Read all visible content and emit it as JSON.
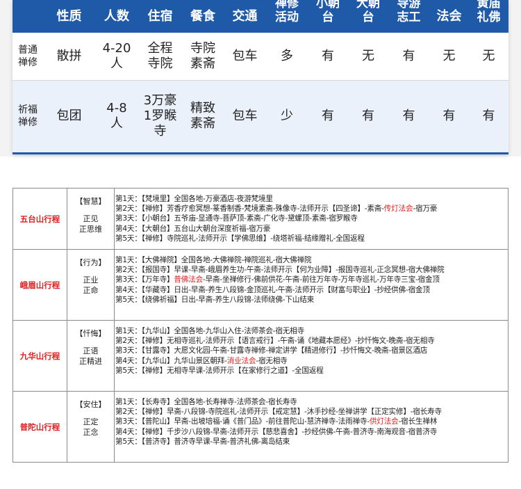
{
  "comparison": {
    "headers": [
      "",
      "性质",
      "人数",
      "住宿",
      "餐食",
      "交通",
      "禅修\n活动",
      "小朝\n台",
      "大朝\n台",
      "导游\n志工",
      "法会",
      "黄庙\n礼佛"
    ],
    "rows": [
      {
        "label": "普通\n禅修",
        "cells": [
          "散拼",
          "4-20\n人",
          "全程\n寺院",
          "寺院\n素斋",
          "包车",
          "多",
          "有",
          "无",
          "有",
          "无",
          "无"
        ],
        "red": [
          true,
          true,
          true,
          false,
          false,
          false,
          false,
          true,
          false,
          true,
          true
        ]
      },
      {
        "label": "祈福\n禅修",
        "cells": [
          "包团",
          "4-8\n人",
          "3万豪\n1罗睺\n寺",
          "精致\n素斋",
          "包车",
          "少",
          "有",
          "有",
          "有",
          "有",
          "有"
        ],
        "red": [
          true,
          true,
          true,
          true,
          false,
          false,
          false,
          true,
          false,
          true,
          true
        ]
      }
    ]
  },
  "itinerary": [
    {
      "name": "五台山行程",
      "tag": "【智慧】",
      "motto": "正见\n正思维",
      "days": [
        {
          "label": "第1天：",
          "parts": [
            {
              "t": "【梵境里】全国各地-万豪酒店-夜游梵境里"
            }
          ]
        },
        {
          "label": "第2天：",
          "parts": [
            {
              "t": "【禅修】芳香疗愈冥想-篆香制香-梵境素斋-殊像寺-法师开示【四圣谛】-素斋-"
            },
            {
              "t": "传灯法会",
              "hl": true
            },
            {
              "t": "-宿万豪"
            }
          ]
        },
        {
          "label": "第3天：",
          "parts": [
            {
              "t": "【小朝台】五爷庙-显通寺-菩萨顶-素斋-广化寺-黛螺顶-素斋-宿罗睺寺"
            }
          ]
        },
        {
          "label": "第4天：",
          "parts": [
            {
              "t": "【大朝台】五台山大朝台深度祈福-宿万豪"
            }
          ]
        },
        {
          "label": "第5天：",
          "parts": [
            {
              "t": "【禅修】寺院巡礼-法师开示【学佛思维】-绕塔祈福-结缘赠礼-全国返程"
            }
          ]
        }
      ]
    },
    {
      "name": "峨眉山行程",
      "tag": "【行为】",
      "motto": "正业\n正命",
      "days": [
        {
          "label": "第1天：",
          "parts": [
            {
              "t": "【大佛禅院】全国各地-大佛禅院-禅院巡礼-宿大佛禅院"
            }
          ]
        },
        {
          "label": "第2天：",
          "parts": [
            {
              "t": "【报国寺】早课-早斋-峨眉养生功-午斋-法师开示【何为业障】-报国寺巡礼-正念冥想-宿大佛禅院"
            }
          ]
        },
        {
          "label": "第3天：",
          "parts": [
            {
              "t": "【万年寺】"
            },
            {
              "t": "普佛法会",
              "hl": true
            },
            {
              "t": "-早斋-坐禅修行-佛前供花-午斋-前往万年寺-万年寺巡礼-万年寺三宝-宿金顶"
            }
          ]
        },
        {
          "label": "第4天：",
          "parts": [
            {
              "t": "【华藏寺】日出-早斋-养生八段锦-金顶巡礼-午斋-法师开示【财富与职业】-抄经供佛-宿金顶"
            }
          ]
        },
        {
          "label": "第5天：",
          "parts": [
            {
              "t": "【绕佛祈福】日出-早斋-养生八段锦-法师绕佛-下山结束"
            }
          ]
        }
      ]
    },
    {
      "name": "九华山行程",
      "tag": "【忏悔】",
      "motto": "正语\n正精进",
      "days": [
        {
          "label": "第1天：",
          "parts": [
            {
              "t": "【九华山】全国各地-九华山入住-法师茶会-宿无相寺"
            }
          ]
        },
        {
          "label": "第2天：",
          "parts": [
            {
              "t": "【禅修】无相寺巡礼-法师开示【语言戒行】-午斋-诵《地藏本愿经》-抄忏悔文-晚斋-宿无相寺"
            }
          ]
        },
        {
          "label": "第3天：",
          "parts": [
            {
              "t": "【甘露寺】大愿文化园-午斋-甘露寺禅修-禅定讲学【精进修行】-抄忏悔文-晚斋-宿景区酒店"
            }
          ]
        },
        {
          "label": "第4天：",
          "parts": [
            {
              "t": "【九华山】九华山景区朝拜-"
            },
            {
              "t": "消业法会",
              "hl": true
            },
            {
              "t": "-宿无相寺"
            }
          ]
        },
        {
          "label": "第5天：",
          "parts": [
            {
              "t": "【禅修】无相寺早课-法师开示【在家修行之道】-全国返程"
            }
          ]
        }
      ]
    },
    {
      "name": "普陀山行程",
      "tag": "【安住】",
      "motto": "正定\n正念",
      "days": [
        {
          "label": "第1天：",
          "parts": [
            {
              "t": "【长寿寺】全国各地-长寿禅寺-法师茶会-宿长寿寺"
            }
          ]
        },
        {
          "label": "第2天：",
          "parts": [
            {
              "t": "【禅修】早斋-八段锦-寺院巡礼-法师开示【戒定慧】-沐手抄经-坐禅讲学【正定实修】-宿长寿寺"
            }
          ]
        },
        {
          "label": "第3天：",
          "parts": [
            {
              "t": "【普陀山】早斋-出坡培福-诵《普门品》-前往普陀山-慧济禅寺-法雨禅寺-"
            },
            {
              "t": "供灯法会",
              "hl": true
            },
            {
              "t": "-宿长生禅林"
            }
          ]
        },
        {
          "label": "第4天：",
          "parts": [
            {
              "t": "【禅修】千步沙八段锦-早斋-法师开示【慈悲喜舍】-抄经供佛-午斋-普济寺-南海观音-宿普济寺"
            }
          ]
        },
        {
          "label": "第5天：",
          "parts": [
            {
              "t": "【普济寺】普济寺早课-早斋-普济礼佛-离岛结束"
            }
          ]
        }
      ]
    }
  ]
}
